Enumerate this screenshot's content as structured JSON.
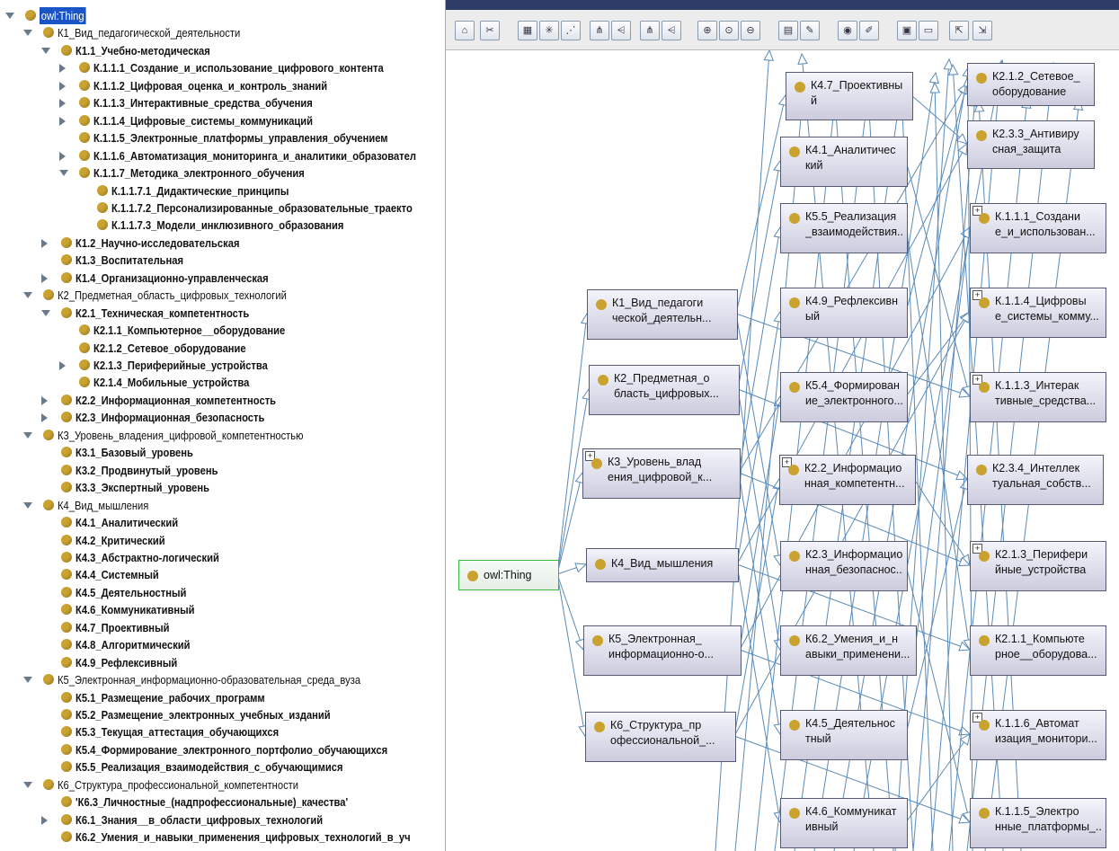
{
  "tree": [
    {
      "label": "owl:Thing",
      "level": 0,
      "toggle": "exp",
      "bold": false,
      "selected": true
    },
    {
      "label": "К1_Вид_педагогической_деятельности",
      "level": 1,
      "toggle": "exp",
      "bold": false
    },
    {
      "label": "К1.1_Учебно-методическая",
      "level": 2,
      "toggle": "exp",
      "bold": true
    },
    {
      "label": "К.1.1.1_Создание_и_использование_цифрового_контента",
      "level": 3,
      "toggle": "col",
      "bold": true
    },
    {
      "label": "К.1.1.2_Цифровая_оценка_и_контроль_знаний",
      "level": 3,
      "toggle": "col",
      "bold": true
    },
    {
      "label": "К.1.1.3_Интерактивные_средства_обучения",
      "level": 3,
      "toggle": "col",
      "bold": true
    },
    {
      "label": "К.1.1.4_Цифровые_системы_коммуникаций",
      "level": 3,
      "toggle": "col",
      "bold": true
    },
    {
      "label": "К.1.1.5_Электронные_платформы_управления_обучением",
      "level": 3,
      "toggle": "none",
      "bold": true
    },
    {
      "label": "К.1.1.6_Автоматизация_мониторинга_и_аналитики_образовател",
      "level": 3,
      "toggle": "col",
      "bold": true
    },
    {
      "label": "К.1.1.7_Методика_электронного_обучения",
      "level": 3,
      "toggle": "exp",
      "bold": true
    },
    {
      "label": "К.1.1.7.1_Дидактические_принципы",
      "level": 4,
      "toggle": "none",
      "bold": true
    },
    {
      "label": "К.1.1.7.2_Персонализированные_образовательные_траекто",
      "level": 4,
      "toggle": "none",
      "bold": true
    },
    {
      "label": "К.1.1.7.3_Модели_инклюзивного_образования",
      "level": 4,
      "toggle": "none",
      "bold": true
    },
    {
      "label": "К1.2_Научно-исследовательская",
      "level": 2,
      "toggle": "col",
      "bold": true
    },
    {
      "label": "К1.3_Воспитательная",
      "level": 2,
      "toggle": "none",
      "bold": true
    },
    {
      "label": "К1.4_Организационно-управленческая",
      "level": 2,
      "toggle": "col",
      "bold": true
    },
    {
      "label": "К2_Предметная_область_цифровых_технологий",
      "level": 1,
      "toggle": "exp",
      "bold": false
    },
    {
      "label": "К2.1_Техническая_компетентность",
      "level": 2,
      "toggle": "exp",
      "bold": true
    },
    {
      "label": "К2.1.1_Компьютерное__оборудование",
      "level": 3,
      "toggle": "none",
      "bold": true
    },
    {
      "label": "К2.1.2_Сетевое_оборудование",
      "level": 3,
      "toggle": "none",
      "bold": true
    },
    {
      "label": "К2.1.3_Периферийные_устройства",
      "level": 3,
      "toggle": "col",
      "bold": true
    },
    {
      "label": "К2.1.4_Мобильные_устройства",
      "level": 3,
      "toggle": "none",
      "bold": true
    },
    {
      "label": "К2.2_Информационная_компетентность",
      "level": 2,
      "toggle": "col",
      "bold": true
    },
    {
      "label": "К2.3_Информационная_безопасность",
      "level": 2,
      "toggle": "col",
      "bold": true
    },
    {
      "label": "К3_Уровень_владения_цифровой_компетентностью",
      "level": 1,
      "toggle": "exp",
      "bold": false
    },
    {
      "label": "К3.1_Базовый_уровень",
      "level": 2,
      "toggle": "none",
      "bold": true
    },
    {
      "label": "К3.2_Продвинутый_уровень",
      "level": 2,
      "toggle": "none",
      "bold": true
    },
    {
      "label": "К3.3_Экспертный_уровень",
      "level": 2,
      "toggle": "none",
      "bold": true
    },
    {
      "label": "К4_Вид_мышления",
      "level": 1,
      "toggle": "exp",
      "bold": false
    },
    {
      "label": "К4.1_Аналитический",
      "level": 2,
      "toggle": "none",
      "bold": true
    },
    {
      "label": "К4.2_Критический",
      "level": 2,
      "toggle": "none",
      "bold": true
    },
    {
      "label": "К4.3_Абстрактно-логический",
      "level": 2,
      "toggle": "none",
      "bold": true
    },
    {
      "label": "К4.4_Системный",
      "level": 2,
      "toggle": "none",
      "bold": true
    },
    {
      "label": "К4.5_Деятельностный",
      "level": 2,
      "toggle": "none",
      "bold": true
    },
    {
      "label": "К4.6_Коммуникативный",
      "level": 2,
      "toggle": "none",
      "bold": true
    },
    {
      "label": "К4.7_Проективный",
      "level": 2,
      "toggle": "none",
      "bold": true
    },
    {
      "label": "К4.8_Алгоритмический",
      "level": 2,
      "toggle": "none",
      "bold": true
    },
    {
      "label": "К4.9_Рефлексивный",
      "level": 2,
      "toggle": "none",
      "bold": true
    },
    {
      "label": "К5_Электронная_информационно-образовательная_среда_вуза",
      "level": 1,
      "toggle": "exp",
      "bold": false
    },
    {
      "label": "К5.1_Размещение_рабочих_программ",
      "level": 2,
      "toggle": "none",
      "bold": true
    },
    {
      "label": "К5.2_Размещение_электронных_учебных_изданий",
      "level": 2,
      "toggle": "none",
      "bold": true
    },
    {
      "label": "К5.3_Текущая_аттестация_обучающихся",
      "level": 2,
      "toggle": "none",
      "bold": true
    },
    {
      "label": "К5.4_Формирование_электронного_портфолио_обучающихся",
      "level": 2,
      "toggle": "none",
      "bold": true
    },
    {
      "label": "К5.5_Реализация_взаимодействия_с_обучающимися",
      "level": 2,
      "toggle": "none",
      "bold": true
    },
    {
      "label": "К6_Структура_профессиональной_компетентности",
      "level": 1,
      "toggle": "exp",
      "bold": false
    },
    {
      "label": "'К6.3_Личностные_(надпрофессиональные)_качества'",
      "level": 2,
      "toggle": "none",
      "bold": true
    },
    {
      "label": "К6.1_Знания__в_области_цифровых_технологий",
      "level": 2,
      "toggle": "col",
      "bold": true
    },
    {
      "label": "К6.2_Умения_и_навыки_применения_цифровых_технологий_в_уч",
      "level": 2,
      "toggle": "none",
      "bold": true
    }
  ],
  "toolbar": [
    "home-icon",
    "cut-icon",
    "grid-icon",
    "asterisk-icon",
    "scatter-icon",
    "tree-down-icon",
    "tree-left-icon",
    "tree-down-icon",
    "tree-left-icon",
    "zoom-in-icon",
    "zoom-fit-icon",
    "zoom-out-icon",
    "save-tree-icon",
    "edit-tree-icon",
    "camera-icon",
    "edit-icon",
    "save-icon",
    "open-icon",
    "export-icon",
    "import-icon"
  ],
  "graph": {
    "nodes": [
      {
        "id": "root",
        "label": "owl:Thing",
        "root": true,
        "plus": false
      },
      {
        "id": "k1",
        "label": "К1_Вид_педагоги\nческой_деятельн...",
        "plus": false
      },
      {
        "id": "k2",
        "label": "К2_Предметная_о\nбласть_цифровых...",
        "plus": false
      },
      {
        "id": "k3",
        "label": "К3_Уровень_влад\nения_цифровой_к...",
        "plus": true
      },
      {
        "id": "k4",
        "label": "К4_Вид_мышления",
        "plus": false
      },
      {
        "id": "k5",
        "label": "К5_Электронная_\nинформационно-о...",
        "plus": false
      },
      {
        "id": "k6",
        "label": "К6_Структура_пр\nофессиональной_...",
        "plus": false
      },
      {
        "id": "k47",
        "label": "К4.7_Проективны\nй",
        "plus": false
      },
      {
        "id": "k41",
        "label": "К4.1_Аналитичес\nкий",
        "plus": false
      },
      {
        "id": "k55",
        "label": "К5.5_Реализация\n_взаимодействия...",
        "plus": false
      },
      {
        "id": "k49",
        "label": "К4.9_Рефлексивн\nый",
        "plus": false
      },
      {
        "id": "k54",
        "label": "К5.4_Формирован\nие_электронного...",
        "plus": false
      },
      {
        "id": "k22",
        "label": "К2.2_Информацио\nнная_компетентн...",
        "plus": true
      },
      {
        "id": "k23",
        "label": "К2.3_Информацио\nнная_безопаснос...",
        "plus": false
      },
      {
        "id": "k62",
        "label": "К6.2_Умения_и_н\nавыки_применени...",
        "plus": false
      },
      {
        "id": "k45",
        "label": "К4.5_Деятельнос\nтный",
        "plus": false
      },
      {
        "id": "k46",
        "label": "К4.6_Коммуникат\nивный",
        "plus": false
      },
      {
        "id": "k212",
        "label": "К2.1.2_Сетевое_\nоборудование",
        "plus": false
      },
      {
        "id": "k233",
        "label": "К2.3.3_Антивиру\nсная_защита",
        "plus": false
      },
      {
        "id": "k1111",
        "label": "К.1.1.1_Создани\nе_и_использован...",
        "plus": true
      },
      {
        "id": "k1114",
        "label": "К.1.1.4_Цифровы\nе_системы_комму...",
        "plus": true
      },
      {
        "id": "k1113",
        "label": "К.1.1.3_Интерак\nтивные_средства...",
        "plus": true
      },
      {
        "id": "k234",
        "label": "К2.3.4_Интеллек\nтуальная_собств...",
        "plus": false
      },
      {
        "id": "k213",
        "label": "К2.1.3_Перифери\nйные_устройства",
        "plus": true
      },
      {
        "id": "k211",
        "label": "К2.1.1_Компьюте\nрное__оборудова...",
        "plus": false
      },
      {
        "id": "k1116",
        "label": "К.1.1.6_Автомат\nизация_монитори...",
        "plus": true
      },
      {
        "id": "k1115",
        "label": "К.1.1.5_Электро\nнные_платформы_...",
        "plus": false
      }
    ]
  }
}
